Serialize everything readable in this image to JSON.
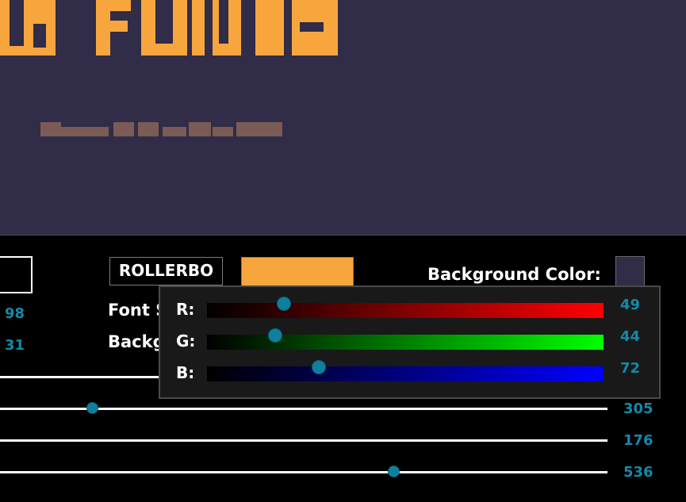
{
  "preview": {
    "background_color": "#312c48",
    "title_color": "#f7a63e",
    "subtitle_color": "#7a5b55"
  },
  "controls": {
    "font_name": "ROLLERBO",
    "font_color": "#f7a63e",
    "background_color_label": "Background Color:",
    "background_color": "#312c48",
    "font_size_label_partial": "Font S",
    "background_label_partial": "Backg",
    "left_values": [
      "98",
      "31"
    ],
    "sliders": [
      {
        "value": "305",
        "fraction": 0.15
      },
      {
        "value": "176",
        "fraction": null
      },
      {
        "value": "536",
        "fraction": 0.65
      }
    ]
  },
  "color_picker": {
    "channels": [
      {
        "label": "R:",
        "value": "49",
        "max": 255,
        "colors": [
          "#000000",
          "#ff0000"
        ]
      },
      {
        "label": "G:",
        "value": "44",
        "max": 255,
        "colors": [
          "#000000",
          "#00ff00"
        ]
      },
      {
        "label": "B:",
        "value": "72",
        "max": 255,
        "colors": [
          "#000000",
          "#0000ff"
        ]
      }
    ],
    "accent_color": "#1589a8"
  }
}
